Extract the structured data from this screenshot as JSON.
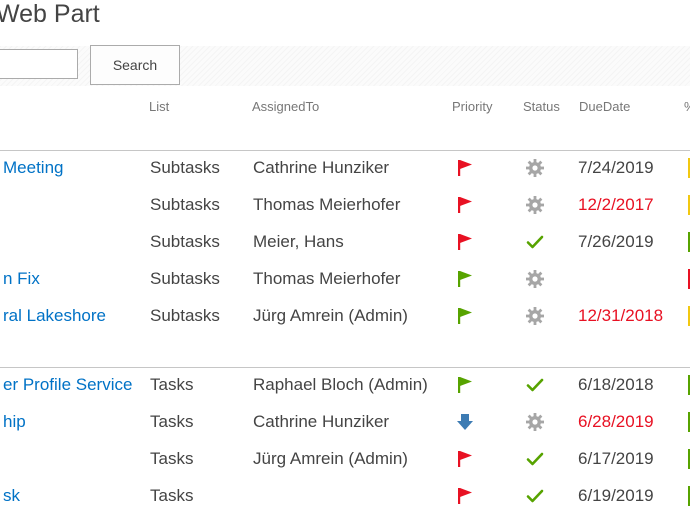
{
  "page": {
    "title": "Web Part"
  },
  "search": {
    "input_value": "",
    "button_label": "Search"
  },
  "columns": {
    "list": "List",
    "assigned_to": "AssignedTo",
    "priority": "Priority",
    "status": "Status",
    "due_date": "DueDate",
    "extra": "%"
  },
  "groups": [
    {
      "rows": [
        {
          "title": "Meeting",
          "list": "Subtasks",
          "assigned_to": "Cathrine Hunziker",
          "priority": "red-flag-icon",
          "status": "gear-icon",
          "due_date": "7/24/2019",
          "overdue": false,
          "bar": "#f2c811"
        },
        {
          "title": "",
          "list": "Subtasks",
          "assigned_to": "Thomas Meierhofer",
          "priority": "red-flag-icon",
          "status": "gear-icon",
          "due_date": "12/2/2017",
          "overdue": true,
          "bar": "#f2c811"
        },
        {
          "title": "",
          "list": "Subtasks",
          "assigned_to": "Meier, Hans",
          "priority": "red-flag-icon",
          "status": "check-icon",
          "due_date": "7/26/2019",
          "overdue": false,
          "bar": "#57a300"
        },
        {
          "title": "n Fix",
          "list": "Subtasks",
          "assigned_to": "Thomas Meierhofer",
          "priority": "green-flag-icon",
          "status": "gear-icon",
          "due_date": "",
          "overdue": false,
          "bar": "#e81123"
        },
        {
          "title": "ral Lakeshore",
          "list": "Subtasks",
          "assigned_to": "Jürg Amrein (Admin)",
          "priority": "green-flag-icon",
          "status": "gear-icon",
          "due_date": "12/31/2018",
          "overdue": true,
          "bar": "#f2c811"
        }
      ]
    },
    {
      "rows": [
        {
          "title": "er Profile Service",
          "list": "Tasks",
          "assigned_to": "Raphael Bloch (Admin)",
          "priority": "green-flag-icon",
          "status": "check-icon",
          "due_date": "6/18/2018",
          "overdue": false,
          "bar": "#57a300"
        },
        {
          "title": "hip",
          "list": "Tasks",
          "assigned_to": "Cathrine Hunziker",
          "priority": "blue-down-arrow-icon",
          "status": "gear-icon",
          "due_date": "6/28/2019",
          "overdue": true,
          "bar": "#57a300"
        },
        {
          "title": "",
          "list": "Tasks",
          "assigned_to": "Jürg Amrein (Admin)",
          "priority": "red-flag-icon",
          "status": "check-icon",
          "due_date": "6/17/2019",
          "overdue": false,
          "bar": "#57a300"
        },
        {
          "title": "sk",
          "list": "Tasks",
          "assigned_to": "",
          "priority": "red-flag-icon",
          "status": "check-icon",
          "due_date": "6/19/2019",
          "overdue": false,
          "bar": "#57a300"
        }
      ]
    }
  ],
  "colors": {
    "link": "#0072c6",
    "overdue": "#e81123",
    "flag_red": "#e81123",
    "flag_green": "#57a300",
    "check_green": "#57a300",
    "gear_gray": "#a6a6a6",
    "arrow_blue": "#3d7bb3"
  }
}
